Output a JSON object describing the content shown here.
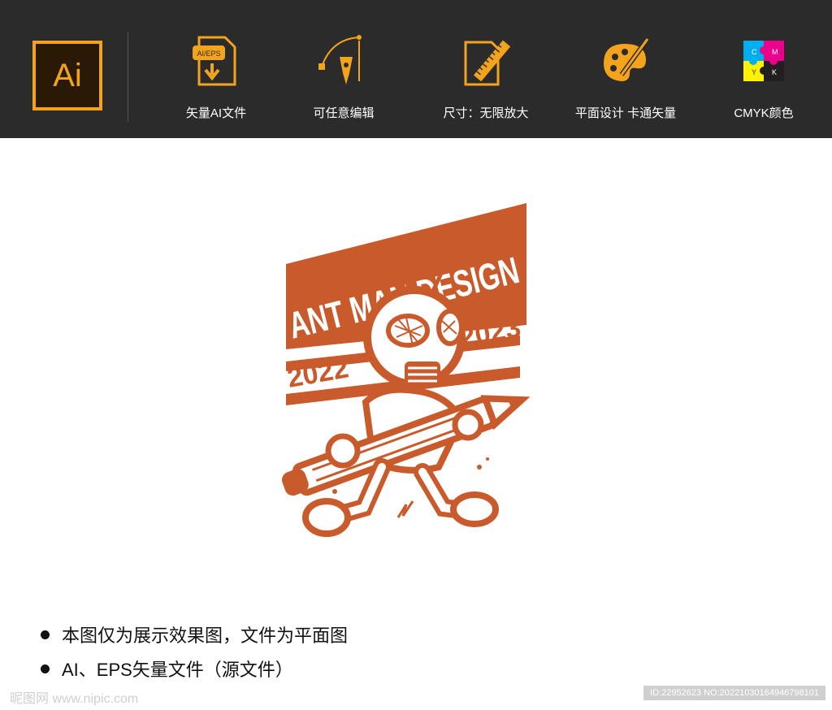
{
  "header": {
    "logo_text": "Ai",
    "features": [
      {
        "label": "矢量AI文件",
        "icon": "ai-eps-download-icon",
        "badge": "AI/EPS"
      },
      {
        "label": "可任意编辑",
        "icon": "pen-tool-icon"
      },
      {
        "label": "尺寸：无限放大",
        "icon": "ruler-document-icon"
      },
      {
        "label": "平面设计  卡通矢量",
        "icon": "paint-palette-icon"
      },
      {
        "label": "CMYK颜色",
        "icon": "cmyk-puzzle-icon",
        "letters": [
          "C",
          "M",
          "Y",
          "K"
        ]
      }
    ]
  },
  "artwork": {
    "title": "ANT MAN DESIGN",
    "year_left": "2022",
    "year_right": "2023",
    "color": "#c95a2b"
  },
  "bullets": [
    "本图仅为展示效果图，文件为平面图",
    "AI、EPS矢量文件（源文件）"
  ],
  "watermark": {
    "left": "昵图网 www.nipic.com",
    "right": "ID:22952623 NO:20221030164946798101"
  },
  "colors": {
    "accent": "#f3a41c",
    "bar": "#2b2b2b",
    "art": "#c95a2b"
  }
}
